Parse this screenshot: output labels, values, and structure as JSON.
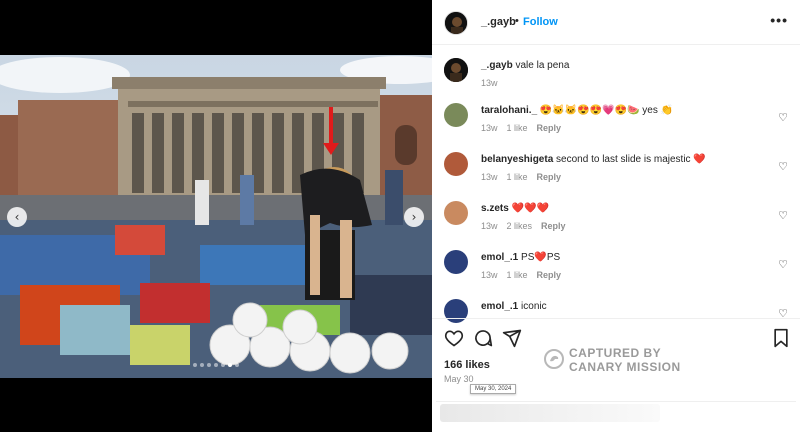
{
  "post": {
    "username": "_.gayb",
    "separator": "•",
    "follow_label": "Follow",
    "more_label": "•••",
    "caption_text": "vale la pena",
    "caption_time": "13w",
    "likes": "166 likes",
    "date": "May 30",
    "date_tooltip": "May 30, 2024"
  },
  "media": {
    "prev_icon": "chevron-left-icon",
    "next_icon": "chevron-right-icon",
    "prev_glyph": "‹",
    "next_glyph": "›",
    "carousel_dots": 7,
    "active_dot": 5
  },
  "comments": [
    {
      "username": "taralohani._",
      "text": "😍🐱🐱😍😍💗😍🍉 yes 👏",
      "time": "13w",
      "likes": "1 like",
      "reply": "Reply",
      "avatar_color": "#7a8a5a"
    },
    {
      "username": "belanyeshigeta",
      "text": "second to last slide is majestic ❤️",
      "time": "13w",
      "likes": "1 like",
      "reply": "Reply",
      "avatar_color": "#b05a3a"
    },
    {
      "username": "s.zets",
      "text": "❤️❤️❤️",
      "time": "13w",
      "likes": "2 likes",
      "reply": "Reply",
      "avatar_color": "#c98a60"
    },
    {
      "username": "emol_.1",
      "text": "PS❤️PS",
      "time": "13w",
      "likes": "1 like",
      "reply": "Reply",
      "avatar_color": "#2a3f7a"
    },
    {
      "username": "emol_.1",
      "text": "iconic",
      "time": "",
      "likes": "",
      "reply": "",
      "avatar_color": "#2a3f7a"
    }
  ],
  "actions": {
    "like_icon": "heart-icon",
    "comment_icon": "comment-icon",
    "share_icon": "share-icon",
    "save_icon": "bookmark-icon",
    "comment_heart_glyph": "♡"
  },
  "watermark": {
    "line1": "CAPTURED BY",
    "line2": "CANARY MISSION",
    "icon": "canary-icon"
  },
  "colors": {
    "accent": "#0095f6",
    "muted": "#8e8e8e",
    "text": "#262626"
  }
}
